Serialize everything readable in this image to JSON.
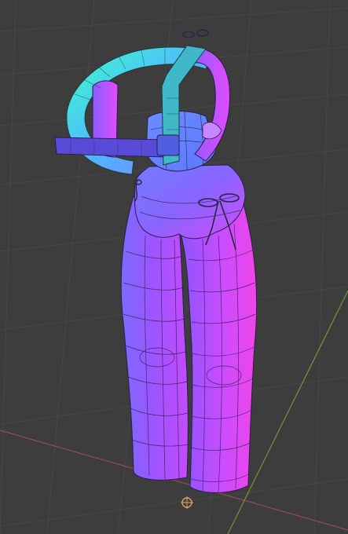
{
  "viewport": {
    "background": "#3d3d3d",
    "grid_color": "#4a4a4a",
    "x_axis_color": "#9a4b4b",
    "y_axis_color": "#6a9a35"
  },
  "scene": {
    "object": "overalls-mesh",
    "shading": "normal-map-matcap",
    "wireframe_overlay": true
  },
  "icons": {
    "origin": "3d-cursor-icon"
  }
}
